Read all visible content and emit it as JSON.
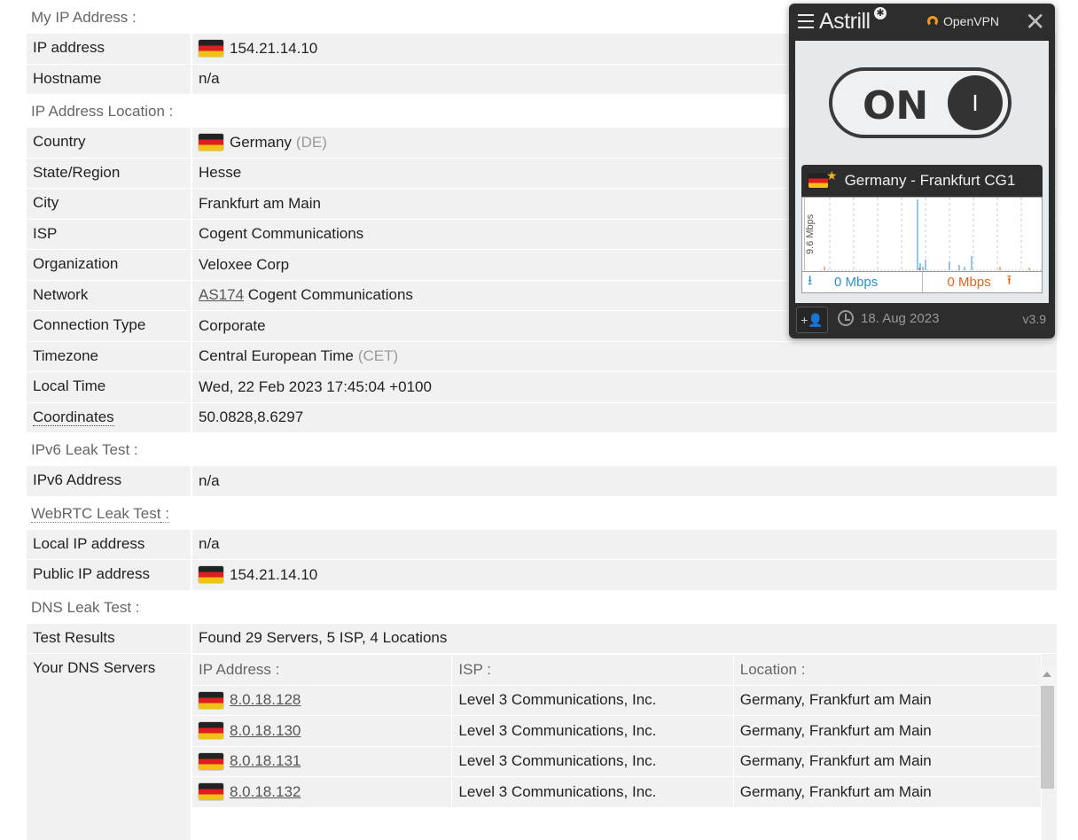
{
  "sections": {
    "my_ip": "My IP Address :",
    "location": "IP Address Location :",
    "ipv6": "IPv6 Leak Test :",
    "webrtc": "WebRTC Leak Test",
    "webrtc_suffix": " :",
    "dns": "DNS Leak Test :"
  },
  "ip": {
    "label": "IP address",
    "value": "154.21.14.10"
  },
  "hostname": {
    "label": "Hostname",
    "value": "n/a"
  },
  "location": {
    "country_label": "Country",
    "country": "Germany",
    "country_code": "(DE)",
    "state_label": "State/Region",
    "state": "Hesse",
    "city_label": "City",
    "city": "Frankfurt am Main",
    "isp_label": "ISP",
    "isp": "Cogent Communications",
    "org_label": "Organization",
    "org": "Veloxee Corp",
    "network_label": "Network",
    "asn": "AS174",
    "network": " Cogent Communications",
    "conn_label": "Connection Type",
    "conn": "Corporate",
    "tz_label": "Timezone",
    "tz": "Central European Time",
    "tz_code": "(CET)",
    "time_label": "Local Time",
    "time": "Wed, 22 Feb 2023 17:45:04 +0100",
    "coord_label": "Coordinates",
    "coord": "50.0828,8.6297"
  },
  "ipv6": {
    "label": "IPv6 Address",
    "value": "n/a"
  },
  "webrtc": {
    "local_label": "Local IP address",
    "local": "n/a",
    "public_label": "Public IP address",
    "public": "154.21.14.10"
  },
  "dns": {
    "results_label": "Test Results",
    "results": "Found 29 Servers, 5 ISP, 4 Locations",
    "servers_label": "Your DNS Servers",
    "headers": {
      "ip": "IP Address :",
      "isp": "ISP :",
      "location": "Location :"
    },
    "rows": [
      {
        "ip": "8.0.18.128",
        "isp": "Level 3 Communications, Inc.",
        "location": "Germany, Frankfurt am Main"
      },
      {
        "ip": "8.0.18.130",
        "isp": "Level 3 Communications, Inc.",
        "location": "Germany, Frankfurt am Main"
      },
      {
        "ip": "8.0.18.131",
        "isp": "Level 3 Communications, Inc.",
        "location": "Germany, Frankfurt am Main"
      },
      {
        "ip": "8.0.18.132",
        "isp": "Level 3 Communications, Inc.",
        "location": "Germany, Frankfurt am Main"
      }
    ]
  },
  "astrill": {
    "brand": "Astrill",
    "protocol": "OpenVPN",
    "toggle": "ON",
    "knob": "I",
    "server": "Germany - Frankfurt CG1",
    "graph_label": "9.6 Mbps",
    "download": "0 Mbps",
    "upload": "0 Mbps",
    "expiry": "18. Aug 2023",
    "version": "v3.9",
    "accent_orange": "#f29b1f",
    "download_color": "#2c8fd0",
    "upload_color": "#e5631b"
  }
}
